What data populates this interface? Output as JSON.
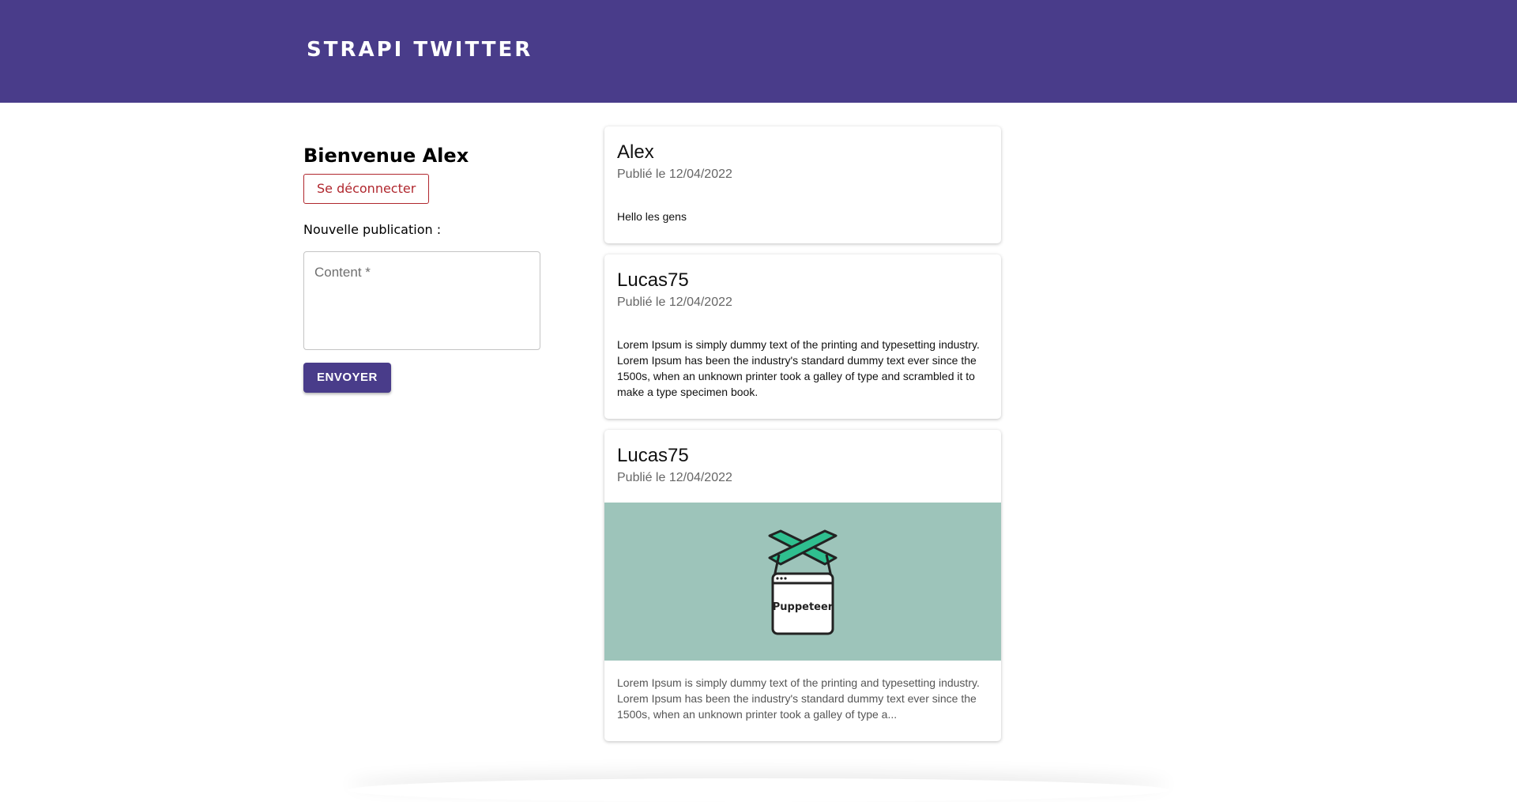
{
  "header": {
    "brand": "STRAPI TWITTER"
  },
  "sidebar": {
    "welcome": "Bienvenue Alex",
    "logout_label": "Se déconnecter",
    "new_publication_label": "Nouvelle publication :",
    "content_placeholder": "Content *",
    "send_label": "ENVOYER"
  },
  "colors": {
    "primary": "#493c8a",
    "danger": "#b0272e",
    "media_bg": "#9dc4ba",
    "logo_green": "#2fbf8f"
  },
  "posts": [
    {
      "author": "Alex",
      "date": "Publié le 12/04/2022",
      "text": "Hello les gens"
    },
    {
      "author": "Lucas75",
      "date": "Publié le 12/04/2022",
      "text": "Lorem Ipsum is simply dummy text of the printing and typesetting industry. Lorem Ipsum has been the industry's standard dummy text ever since the 1500s, when an unknown printer took a galley of type and scrambled it to make a type specimen book."
    },
    {
      "author": "Lucas75",
      "date": "Publié le 12/04/2022",
      "image_label": "Puppeteer",
      "image_icon": "puppeteer-logo-icon",
      "text": "Lorem Ipsum is simply dummy text of the printing and typesetting industry. Lorem Ipsum has been the industry's standard dummy text ever since the 1500s, when an unknown printer took a galley of type a..."
    }
  ]
}
